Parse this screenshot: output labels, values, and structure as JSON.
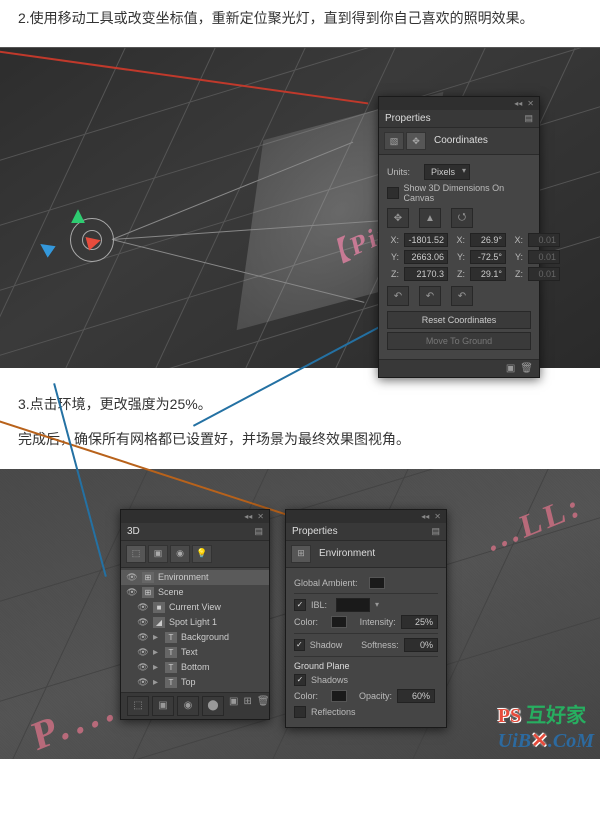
{
  "text": {
    "step2": "2.使用移动工具或改变坐标值，重新定位聚光灯，直到得到你自己喜欢的照明效果。",
    "step3": "3.点击环境，更改强度为25%。",
    "step3b": "完成后，确保所有网格都已设置好，并场景为最终效果图视角。"
  },
  "ss1": {
    "text3d": "【Pix...",
    "panel": {
      "title": "Properties",
      "tab": "Coordinates",
      "units_lbl": "Units:",
      "units_val": "Pixels",
      "show_dims": "Show 3D Dimensions On Canvas",
      "coords": {
        "X_pos": "-1801.52",
        "X_rot": "26.9°",
        "X_scl": "0.01",
        "Y_pos": "2663.06",
        "Y_rot": "-72.5°",
        "Y_scl": "0.01",
        "Z_pos": "2170.3",
        "Z_rot": "29.1°",
        "Z_scl": "0.01"
      },
      "reset_btn": "Reset Coordinates",
      "move_btn": "Move To Ground"
    }
  },
  "ss2": {
    "text3d_right": "...LL:",
    "text3d_bottom": "P....",
    "panel3d": {
      "title": "3D",
      "items": [
        "Environment",
        "Scene",
        "Current View",
        "Spot Light 1",
        "Background",
        "Text",
        "Bottom",
        "Top"
      ]
    },
    "panelProps": {
      "title": "Properties",
      "tab": "Environment",
      "global_amb": "Global Ambient:",
      "ibl": "IBL:",
      "color": "Color:",
      "intensity": "Intensity:",
      "intensity_val": "25%",
      "shadow": "Shadow",
      "softness": "Softness:",
      "softness_val": "0%",
      "ground": "Ground Plane",
      "shadows": "Shadows",
      "opacity": "Opacity:",
      "opacity_val": "60%",
      "reflections": "Reflections"
    },
    "watermark_hr": "PS 互 好 家",
    "watermark": "PS 互好家 UiB X.CoM"
  }
}
